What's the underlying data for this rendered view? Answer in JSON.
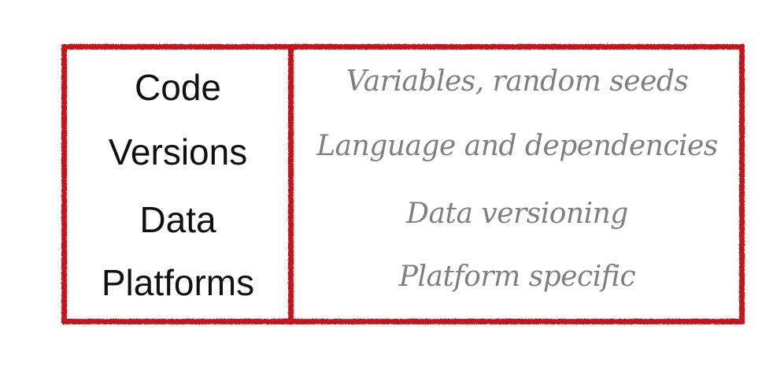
{
  "colors": {
    "frame": "#c0121d",
    "left_text": "#111111",
    "right_text": "#7f7f7f"
  },
  "rows": [
    {
      "category": "Code",
      "description": "Variables, random seeds"
    },
    {
      "category": "Versions",
      "description": "Language and dependencies"
    },
    {
      "category": "Data",
      "description": "Data versioning"
    },
    {
      "category": "Platforms",
      "description": "Platform specific"
    }
  ]
}
